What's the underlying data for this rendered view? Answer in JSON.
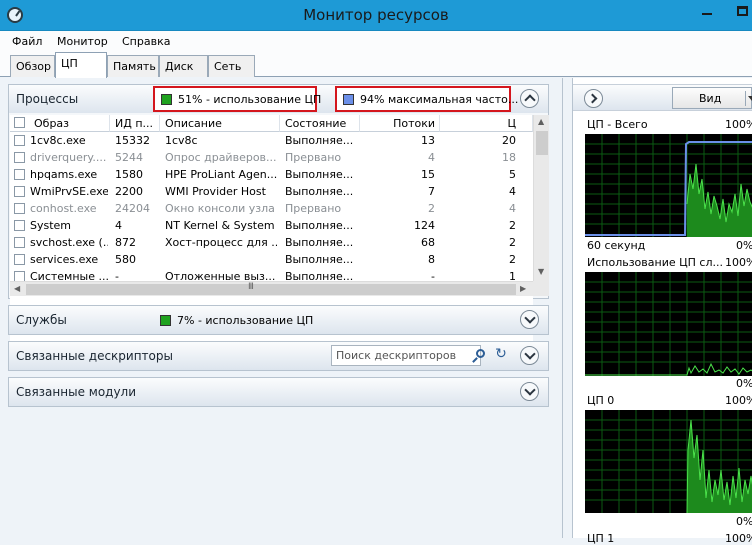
{
  "window": {
    "title": "Монитор ресурсов"
  },
  "menu": [
    "Файл",
    "Монитор",
    "Справка"
  ],
  "tabs": [
    "Обзор",
    "ЦП",
    "Память",
    "Диск",
    "Сеть"
  ],
  "processes": {
    "title": "Процессы",
    "cpu_usage_badge": "51% - использование ЦП",
    "max_freq_badge": "94% максимальная часто...",
    "columns": [
      "Образ",
      "ИД п...",
      "Описание",
      "Состояние",
      "Потоки",
      "Ц"
    ],
    "rows": [
      {
        "image": "1cv8c.exe",
        "pid": "15332",
        "description": "1cv8c",
        "state": "Выполняе...",
        "threads": "13",
        "cpu": "20",
        "dim": false
      },
      {
        "image": "driverquery....",
        "pid": "5244",
        "description": "Опрос драйверов...",
        "state": "Прервано",
        "threads": "4",
        "cpu": "18",
        "dim": true
      },
      {
        "image": "hpqams.exe",
        "pid": "1580",
        "description": "HPE ProLiant Agen...",
        "state": "Выполняе...",
        "threads": "15",
        "cpu": "5",
        "dim": false
      },
      {
        "image": "WmiPrvSE.exe",
        "pid": "2200",
        "description": "WMI Provider Host",
        "state": "Выполняе...",
        "threads": "7",
        "cpu": "4",
        "dim": false
      },
      {
        "image": "conhost.exe",
        "pid": "24204",
        "description": "Окно консоли узла",
        "state": "Прервано",
        "threads": "2",
        "cpu": "4",
        "dim": true
      },
      {
        "image": "System",
        "pid": "4",
        "description": "NT Kernel & System",
        "state": "Выполняе...",
        "threads": "124",
        "cpu": "2",
        "dim": false
      },
      {
        "image": "svchost.exe (...",
        "pid": "872",
        "description": "Хост-процесс для ...",
        "state": "Выполняе...",
        "threads": "68",
        "cpu": "2",
        "dim": false
      },
      {
        "image": "services.exe",
        "pid": "580",
        "description": "",
        "state": "Выполняе...",
        "threads": "8",
        "cpu": "2",
        "dim": false
      },
      {
        "image": "Системные ...",
        "pid": "-",
        "description": "Отложенные выз...",
        "state": "Выполняе...",
        "threads": "-",
        "cpu": "1",
        "dim": false
      }
    ]
  },
  "services": {
    "title": "Службы",
    "cpu_usage": "7% - использование ЦП"
  },
  "handles": {
    "title": "Связанные дескрипторы",
    "search_placeholder": "Поиск дескрипторов"
  },
  "modules": {
    "title": "Связанные модули"
  },
  "right_pane": {
    "view_label": "Вид",
    "graphs": [
      {
        "label": "ЦП - Всего",
        "max": "100%",
        "time_label": "60 секунд",
        "min": "0%"
      },
      {
        "label": "Использование ЦП сл...",
        "max": "100%",
        "min": "0%"
      },
      {
        "label": "ЦП 0",
        "max": "100%",
        "min": "0%"
      },
      {
        "label": "ЦП 1",
        "max": "100%"
      }
    ]
  },
  "colors": {
    "titlebar": "#1e9ad6",
    "cpu_green": "#1fa21f",
    "freq_blue": "#6b8fe8",
    "badge_border": "#d4161d"
  }
}
